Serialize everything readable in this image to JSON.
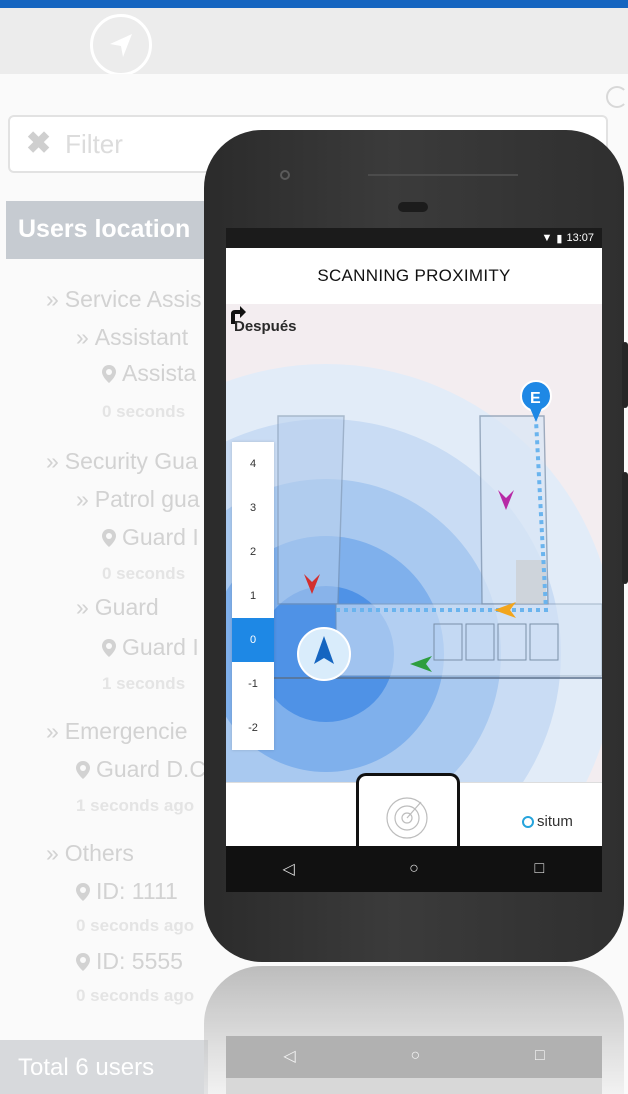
{
  "colors": {
    "accent": "#1565c0",
    "map_blue": "#1e88e5",
    "header_grey": "#c6cbd1",
    "situm": "#26a4dc"
  },
  "navbar": {
    "icon": "navigation-arrow-icon"
  },
  "filter": {
    "icon": "close-icon",
    "placeholder": "Filter"
  },
  "users_header": "Users location",
  "tree": {
    "service": "Service Assis",
    "assistant": "Assistant",
    "assistant_loc": "Assista",
    "assistant_time": "0 seconds",
    "security": "Security Gua",
    "patrol": "Patrol gua",
    "patrol_loc": "Guard I",
    "patrol_time": "0 seconds",
    "guard": "Guard",
    "guard_loc": "Guard I",
    "guard_time": "1 seconds",
    "emergencies": "Emergencie",
    "emerg_loc": "Guard D.C",
    "emerg_time": "1 seconds ago",
    "others": "Others",
    "id1": "ID: 1111",
    "id1_time": "0 seconds ago",
    "id2": "ID: 5555",
    "id2_time": "0 seconds ago"
  },
  "total": "Total 6 users",
  "phone": {
    "status_time": "13:07",
    "title": "SCANNING PROXIMITY",
    "next_label": "Después",
    "floors": [
      "4",
      "3",
      "2",
      "1",
      "0",
      "-1",
      "-2"
    ],
    "active_floor": "0",
    "brand": "situm",
    "nav_keys": [
      "◁",
      "○",
      "□"
    ]
  }
}
